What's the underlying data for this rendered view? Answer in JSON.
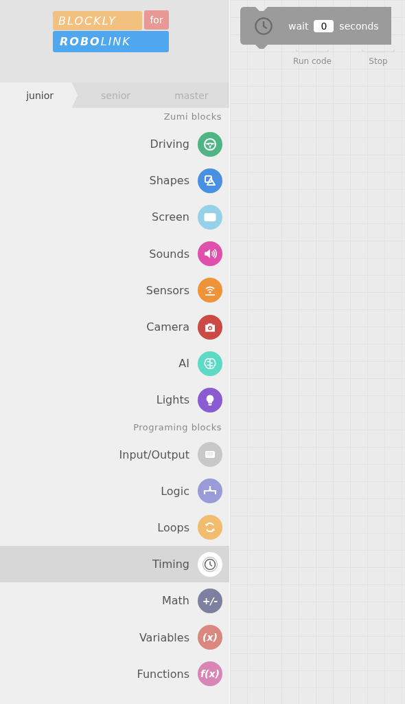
{
  "logo": {
    "top": "BLOCKLY",
    "badge": "for",
    "bottom_start": "ROBO",
    "bottom_end": "LINK"
  },
  "tabs": [
    {
      "label": "junior",
      "selected": true
    },
    {
      "label": "senior",
      "selected": false
    },
    {
      "label": "master",
      "selected": false
    }
  ],
  "sections": [
    {
      "title": "Zumi blocks",
      "items": [
        {
          "label": "Driving",
          "color": "#4fb584",
          "selected": false
        },
        {
          "label": "Shapes",
          "color": "#4a90e2",
          "selected": false
        },
        {
          "label": "Screen",
          "color": "#95d2e8",
          "selected": false
        },
        {
          "label": "Sounds",
          "color": "#e04fab",
          "selected": false
        },
        {
          "label": "Sensors",
          "color": "#ee9337",
          "selected": false
        },
        {
          "label": "Camera",
          "color": "#cc4a44",
          "selected": false
        },
        {
          "label": "AI",
          "color": "#5ddac5",
          "selected": false
        },
        {
          "label": "Lights",
          "color": "#8a5bd1",
          "selected": false
        }
      ]
    },
    {
      "title": "Programing blocks",
      "items": [
        {
          "label": "Input/Output",
          "color": "#c8c8c8",
          "selected": false
        },
        {
          "label": "Logic",
          "color": "#9a9cd9",
          "selected": false
        },
        {
          "label": "Loops",
          "color": "#f2bb6e",
          "selected": false
        },
        {
          "label": "Timing",
          "color": "#ffffff",
          "selected": true
        },
        {
          "label": "Math",
          "color": "#7d819f",
          "selected": false,
          "glyph": "+/-"
        },
        {
          "label": "Variables",
          "color": "#d9877f",
          "selected": false,
          "glyph": "(x)"
        },
        {
          "label": "Functions",
          "color": "#d886b5",
          "selected": false,
          "glyph": "f(x)"
        }
      ]
    }
  ],
  "workspace": {
    "block": {
      "label": "wait",
      "value": "0",
      "unit": "seconds"
    },
    "buttons": [
      {
        "label": "Run code"
      },
      {
        "label": "Stop"
      }
    ]
  }
}
